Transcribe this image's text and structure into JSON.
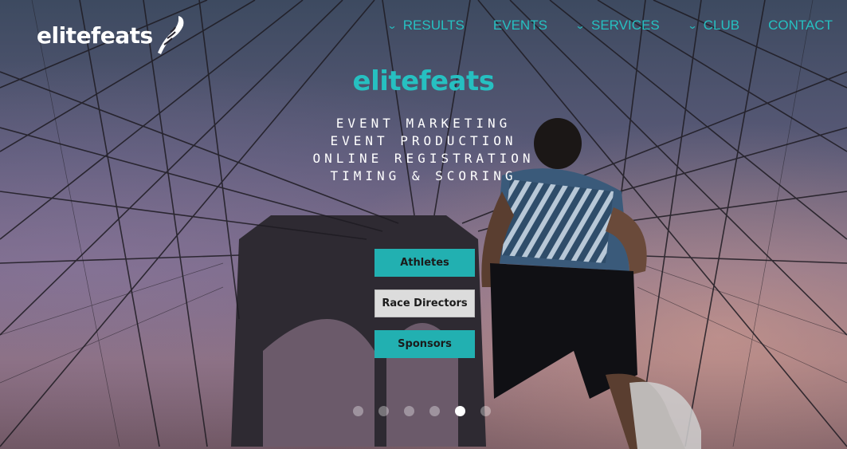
{
  "header": {
    "logo_text": "elitefeats"
  },
  "nav": {
    "items": [
      {
        "label": "RESULTS",
        "has_dropdown": true
      },
      {
        "label": "EVENTS",
        "has_dropdown": false
      },
      {
        "label": "SERVICES",
        "has_dropdown": true
      },
      {
        "label": "CLUB",
        "has_dropdown": true
      },
      {
        "label": "CONTACT",
        "has_dropdown": false
      }
    ]
  },
  "hero": {
    "title": "elitefeats",
    "services": [
      "EVENT MARKETING",
      "EVENT PRODUCTION",
      "ONLINE REGISTRATION",
      "TIMING & SCORING"
    ],
    "buttons": [
      {
        "label": "Athletes"
      },
      {
        "label": "Race Directors"
      },
      {
        "label": "Sponsors"
      }
    ]
  },
  "slider": {
    "count": 6,
    "active_index": 4
  },
  "colors": {
    "accent": "#26c0c1",
    "button_teal": "#22b0b1",
    "button_grey": "#dcdcdc"
  }
}
